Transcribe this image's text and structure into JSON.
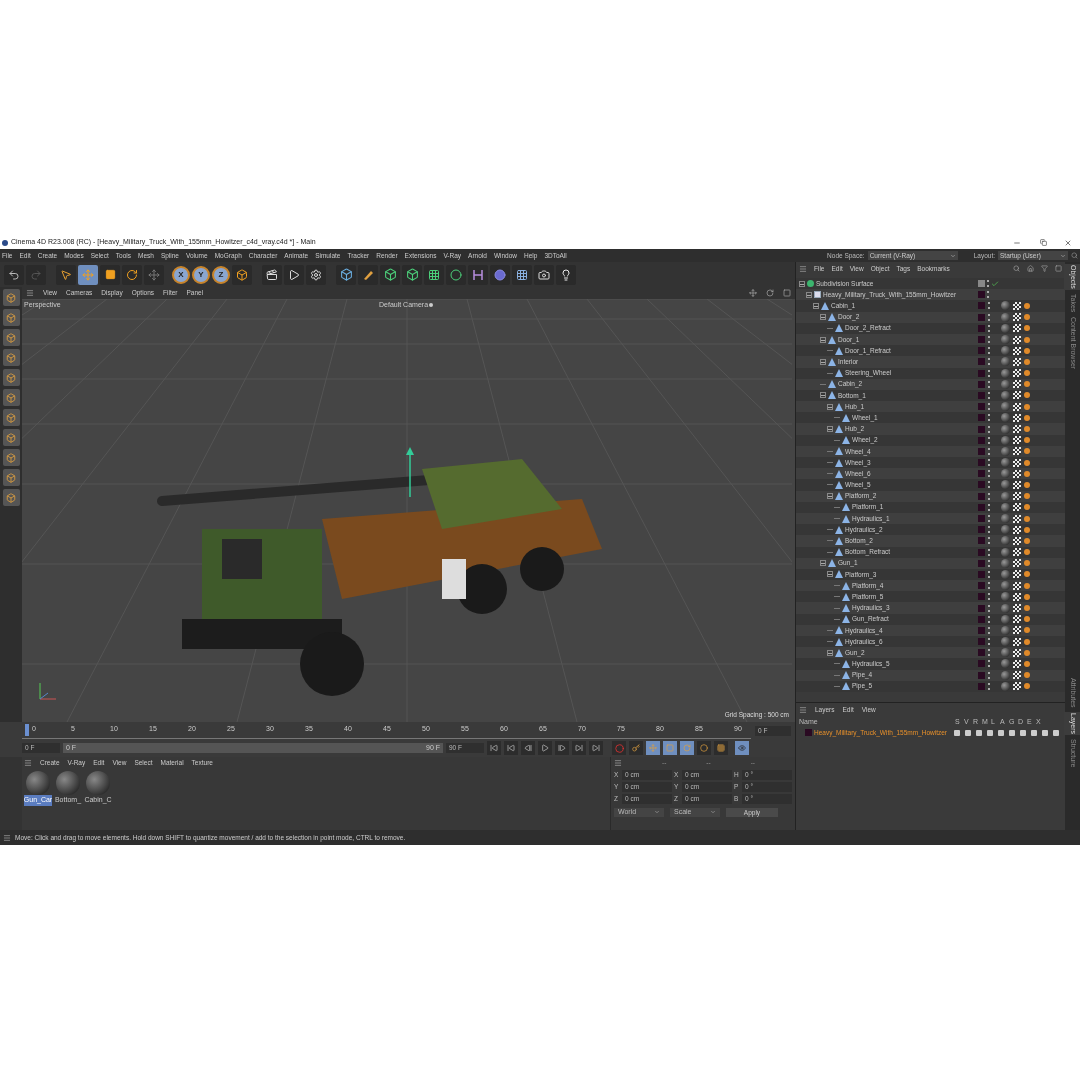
{
  "window": {
    "title": "Cinema 4D R23.008 (RC) - [Heavy_Military_Truck_With_155mm_Howitzer_c4d_vray.c4d *] - Main"
  },
  "menu": [
    "File",
    "Edit",
    "Create",
    "Modes",
    "Select",
    "Tools",
    "Mesh",
    "Spline",
    "Volume",
    "MoGraph",
    "Character",
    "Animate",
    "Simulate",
    "Tracker",
    "Render",
    "Extensions",
    "V-Ray",
    "Arnold",
    "Window",
    "Help",
    "3DToAll"
  ],
  "node_space": {
    "label": "Node Space:",
    "value": "Current (V-Ray)"
  },
  "layout": {
    "label": "Layout:",
    "value": "Startup (User)"
  },
  "tools": [
    {
      "kind": "select",
      "selected": false
    },
    {
      "kind": "move",
      "selected": true
    },
    {
      "kind": "scale",
      "selected": false
    },
    {
      "kind": "rotate",
      "selected": false
    }
  ],
  "axes": [
    {
      "label": "X",
      "selected": true
    },
    {
      "label": "Y",
      "selected": true
    },
    {
      "label": "Z",
      "selected": true
    }
  ],
  "viewport": {
    "menu": [
      "View",
      "Cameras",
      "Display",
      "Options",
      "Filter",
      "Panel"
    ],
    "view_name": "Perspective",
    "camera": "Default Camera",
    "grid_spacing": "Grid Spacing : 500 cm"
  },
  "timeline": {
    "ticks": [
      "0",
      "5",
      "10",
      "15",
      "20",
      "25",
      "30",
      "35",
      "40",
      "45",
      "50",
      "55",
      "60",
      "65",
      "70",
      "75",
      "80",
      "85",
      "90"
    ],
    "current": "0 F",
    "start": "0 F",
    "bar_start": "0 F",
    "bar_end": "90 F",
    "end": "90 F",
    "level": 1
  },
  "materials": {
    "menu": [
      "Create",
      "V-Ray",
      "Edit",
      "View",
      "Select",
      "Material",
      "Texture"
    ],
    "items": [
      {
        "name": "Gun_Car",
        "selected": true
      },
      {
        "name": "Bottom_",
        "selected": false
      },
      {
        "name": "Cabin_C",
        "selected": false
      }
    ]
  },
  "coordinates": {
    "headers": [
      "--",
      "--",
      "--"
    ],
    "rows": [
      {
        "a1": "X",
        "v1": "0 cm",
        "a2": "X",
        "v2": "0 cm",
        "a3": "H",
        "v3": "0 °"
      },
      {
        "a1": "Y",
        "v1": "0 cm",
        "a2": "Y",
        "v2": "0 cm",
        "a3": "P",
        "v3": "0 °"
      },
      {
        "a1": "Z",
        "v1": "0 cm",
        "a2": "Z",
        "v2": "0 cm",
        "a3": "B",
        "v3": "0 °"
      }
    ],
    "mode": "World",
    "transform": "Scale",
    "apply": "Apply"
  },
  "objects": {
    "menu": [
      "File",
      "Edit",
      "View",
      "Object",
      "Tags",
      "Bookmarks"
    ],
    "tree": [
      {
        "name": "Subdivision Surface",
        "kind": "generator",
        "expanded": true,
        "children": [
          {
            "name": "Heavy_Military_Truck_With_155mm_Howitzer",
            "kind": "null",
            "expanded": true,
            "children": [
              {
                "name": "Cabin_1",
                "kind": "mesh",
                "expanded": true,
                "children": [
                  {
                    "name": "Door_2",
                    "kind": "mesh",
                    "expanded": true,
                    "children": [
                      {
                        "name": "Door_2_Refract",
                        "kind": "mesh"
                      }
                    ]
                  },
                  {
                    "name": "Door_1",
                    "kind": "mesh",
                    "expanded": true,
                    "children": [
                      {
                        "name": "Door_1_Refract",
                        "kind": "mesh"
                      }
                    ]
                  },
                  {
                    "name": "Interior",
                    "kind": "mesh",
                    "expanded": true,
                    "children": [
                      {
                        "name": "Steering_Wheel",
                        "kind": "mesh"
                      }
                    ]
                  },
                  {
                    "name": "Cabin_2",
                    "kind": "mesh"
                  },
                  {
                    "name": "Bottom_1",
                    "kind": "mesh",
                    "expanded": true,
                    "children": [
                      {
                        "name": "Hub_1",
                        "kind": "mesh",
                        "expanded": true,
                        "children": [
                          {
                            "name": "Wheel_1",
                            "kind": "mesh"
                          }
                        ]
                      },
                      {
                        "name": "Hub_2",
                        "kind": "mesh",
                        "expanded": true,
                        "children": [
                          {
                            "name": "Wheel_2",
                            "kind": "mesh"
                          }
                        ]
                      },
                      {
                        "name": "Wheel_4",
                        "kind": "mesh"
                      },
                      {
                        "name": "Wheel_3",
                        "kind": "mesh"
                      },
                      {
                        "name": "Wheel_6",
                        "kind": "mesh"
                      },
                      {
                        "name": "Wheel_5",
                        "kind": "mesh"
                      },
                      {
                        "name": "Platform_2",
                        "kind": "mesh",
                        "expanded": true,
                        "children": [
                          {
                            "name": "Platform_1",
                            "kind": "mesh"
                          },
                          {
                            "name": "Hydraulics_1",
                            "kind": "mesh"
                          }
                        ]
                      },
                      {
                        "name": "Hydraulics_2",
                        "kind": "mesh"
                      },
                      {
                        "name": "Bottom_2",
                        "kind": "mesh"
                      },
                      {
                        "name": "Bottom_Refract",
                        "kind": "mesh"
                      }
                    ]
                  },
                  {
                    "name": "Gun_1",
                    "kind": "mesh",
                    "expanded": true,
                    "children": [
                      {
                        "name": "Platform_3",
                        "kind": "mesh",
                        "expanded": true,
                        "children": [
                          {
                            "name": "Platform_4",
                            "kind": "mesh"
                          },
                          {
                            "name": "Platform_5",
                            "kind": "mesh"
                          },
                          {
                            "name": "Hydraulics_3",
                            "kind": "mesh"
                          },
                          {
                            "name": "Gun_Refract",
                            "kind": "mesh"
                          }
                        ]
                      },
                      {
                        "name": "Hydraulics_4",
                        "kind": "mesh"
                      },
                      {
                        "name": "Hydraulics_6",
                        "kind": "mesh"
                      },
                      {
                        "name": "Gun_2",
                        "kind": "mesh",
                        "expanded": true,
                        "children": [
                          {
                            "name": "Hydraulics_5",
                            "kind": "mesh"
                          },
                          {
                            "name": "Pipe_4",
                            "kind": "mesh"
                          },
                          {
                            "name": "Pipe_5",
                            "kind": "mesh"
                          }
                        ]
                      }
                    ]
                  }
                ]
              }
            ]
          }
        ]
      }
    ]
  },
  "layers": {
    "menu": [
      "Layers",
      "Edit",
      "View"
    ],
    "name_header": "Name",
    "columns": [
      "S",
      "V",
      "R",
      "M",
      "L",
      "A",
      "G",
      "D",
      "E",
      "X"
    ],
    "rows": [
      {
        "name": "Heavy_Military_Truck_With_155mm_Howitzer"
      }
    ]
  },
  "side_tabs_top": [
    {
      "label": "Objects",
      "selected": true
    },
    {
      "label": "Takes",
      "selected": false
    },
    {
      "label": "Content Browser",
      "selected": false
    }
  ],
  "side_tabs_bottom": [
    {
      "label": "Attributes",
      "selected": false
    },
    {
      "label": "Layers",
      "selected": true
    },
    {
      "label": "Structure",
      "selected": false
    }
  ],
  "status_bar": "Move: Click and drag to move elements. Hold down SHIFT to quantize movement / add to the selection in point mode, CTRL to remove."
}
